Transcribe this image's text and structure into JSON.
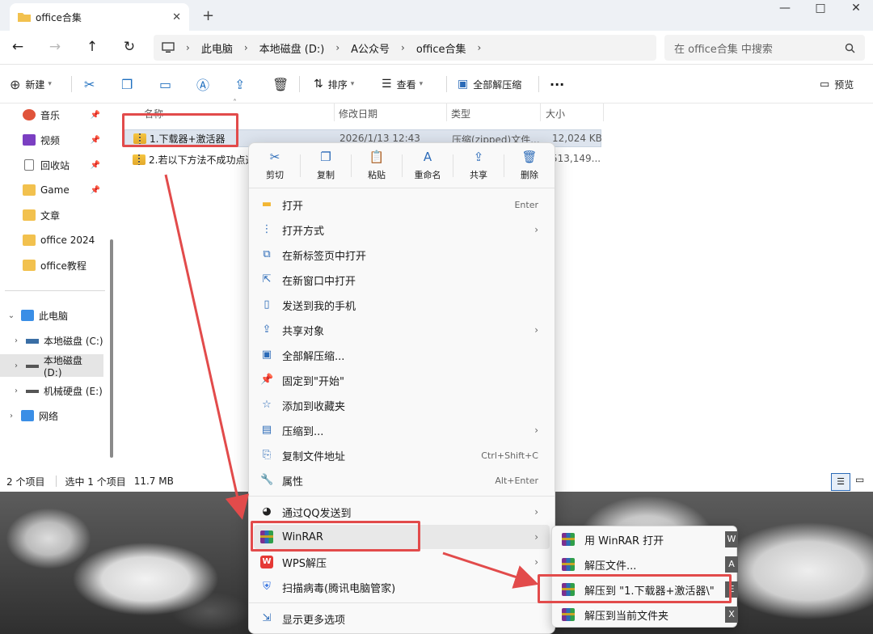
{
  "window": {
    "tab_title": "office合集",
    "new_tab": "+",
    "controls": {
      "minimize": "—",
      "maximize": "□",
      "close": "✕"
    }
  },
  "nav": {
    "back": "←",
    "forward": "→",
    "up": "↑",
    "refresh": "↻",
    "expand": "›"
  },
  "address": {
    "crumbs": [
      "此电脑",
      "本地磁盘 (D:)",
      "A公众号",
      "office合集"
    ],
    "separator": "›"
  },
  "search": {
    "placeholder": "在 office合集 中搜索"
  },
  "toolbar": {
    "new": "新建",
    "sort": "排序",
    "view": "查看",
    "extract_all": "全部解压缩",
    "more": "···",
    "preview": "预览"
  },
  "sidebar": {
    "quick": [
      {
        "label": "音乐"
      },
      {
        "label": "视频"
      },
      {
        "label": "回收站"
      },
      {
        "label": "Game"
      },
      {
        "label": "文章"
      },
      {
        "label": "office 2024"
      },
      {
        "label": "office教程"
      }
    ],
    "this_pc": "此电脑",
    "drives": [
      {
        "label": "本地磁盘 (C:)"
      },
      {
        "label": "本地磁盘 (D:)"
      },
      {
        "label": "机械硬盘 (E:)"
      }
    ],
    "network": "网络"
  },
  "columns": {
    "name": "名称",
    "date": "修改日期",
    "type": "类型",
    "size": "大小"
  },
  "files": [
    {
      "name": "1.下载器+激活器",
      "date": "2026/1/13 12:43",
      "type": "压缩(zipped)文件...",
      "size": "12,024 KB"
    },
    {
      "name": "2.若以下方法不成功点这",
      "date": "",
      "type": "",
      "size": "513,149..."
    }
  ],
  "status": {
    "count": "2 个项目",
    "selected": "选中 1 个项目",
    "size": "11.7 MB"
  },
  "context_menu": {
    "quick_actions": [
      {
        "label": "剪切",
        "icon": "✂"
      },
      {
        "label": "复制",
        "icon": "❐"
      },
      {
        "label": "粘贴",
        "icon": "📋"
      },
      {
        "label": "重命名",
        "icon": "A"
      },
      {
        "label": "共享",
        "icon": "⇪"
      },
      {
        "label": "删除",
        "icon": "🗑"
      }
    ],
    "items": [
      {
        "label": "打开",
        "shortcut": "Enter",
        "icon": "▬"
      },
      {
        "label": "打开方式",
        "shortcut": "",
        "icon": "⋮"
      },
      {
        "label": "在新标签页中打开",
        "shortcut": "",
        "icon": "⧉"
      },
      {
        "label": "在新窗口中打开",
        "shortcut": "",
        "icon": "⇱"
      },
      {
        "label": "发送到我的手机",
        "shortcut": "",
        "icon": "▯"
      },
      {
        "label": "共享对象",
        "shortcut": "",
        "icon": "⇪"
      },
      {
        "label": "全部解压缩...",
        "shortcut": "",
        "icon": "▣"
      },
      {
        "label": "固定到\"开始\"",
        "shortcut": "",
        "icon": "📌"
      },
      {
        "label": "添加到收藏夹",
        "shortcut": "",
        "icon": "☆"
      },
      {
        "label": "压缩到...",
        "shortcut": "",
        "icon": "▤"
      },
      {
        "label": "复制文件地址",
        "shortcut": "Ctrl+Shift+C",
        "icon": "⎘"
      },
      {
        "label": "属性",
        "shortcut": "Alt+Enter",
        "icon": "🔧"
      },
      {
        "label": "通过QQ发送到",
        "shortcut": "",
        "icon": "◕"
      },
      {
        "label": "WinRAR",
        "shortcut": "",
        "icon": ""
      },
      {
        "label": "WPS解压",
        "shortcut": "",
        "icon": "W"
      },
      {
        "label": "扫描病毒(腾讯电脑管家)",
        "shortcut": "",
        "icon": "⛨"
      },
      {
        "label": "显示更多选项",
        "shortcut": "",
        "icon": "⇲"
      }
    ],
    "arrow": "›"
  },
  "winrar_submenu": [
    {
      "label": "用 WinRAR 打开",
      "key": "W"
    },
    {
      "label": "解压文件...",
      "key": "A"
    },
    {
      "label": "解压到 \"1.下载器+激活器\\\"",
      "key": "E"
    },
    {
      "label": "解压到当前文件夹",
      "key": "X"
    }
  ],
  "colors": {
    "annotation_red": "#e24b4b",
    "accent": "#2c6bb8"
  }
}
